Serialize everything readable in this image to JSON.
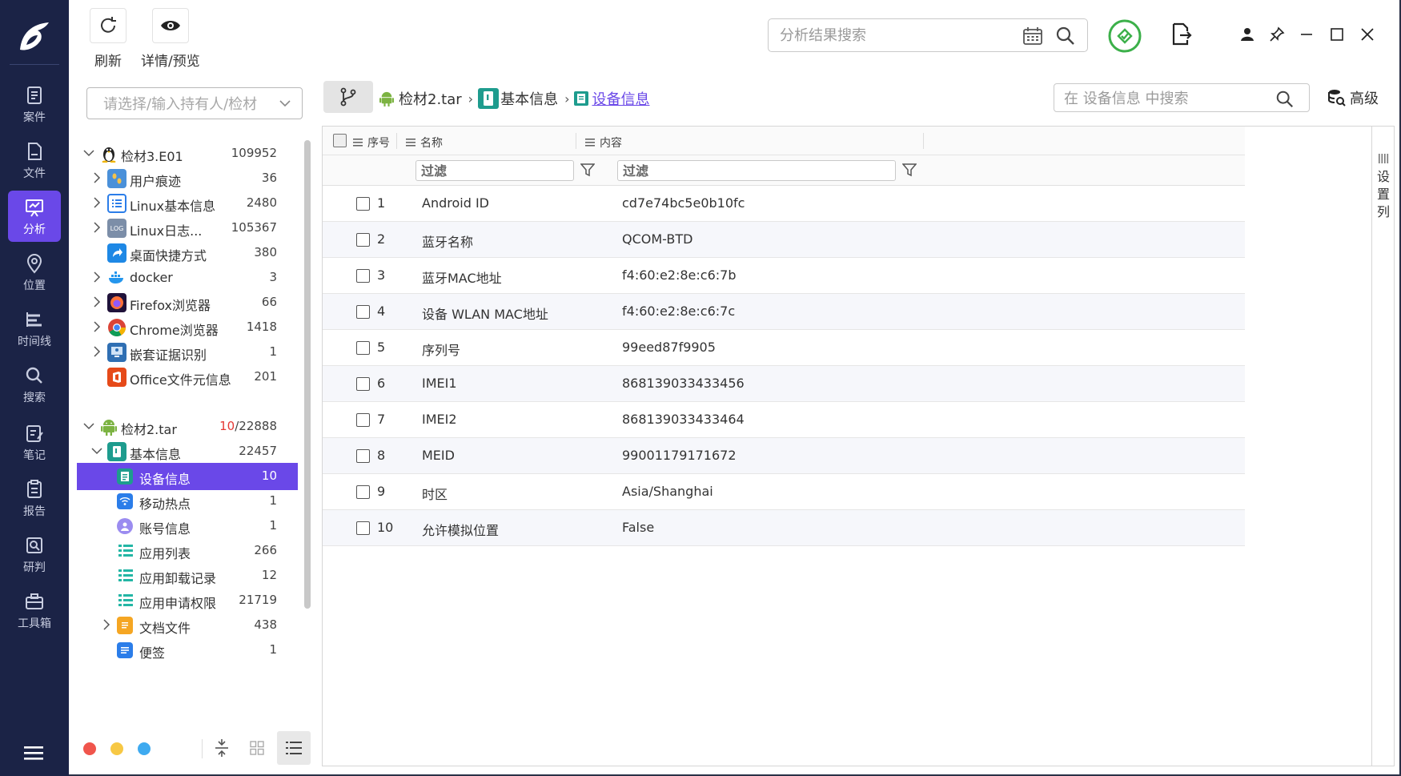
{
  "nav": {
    "items": [
      {
        "label": "案件",
        "icon": "case-icon"
      },
      {
        "label": "文件",
        "icon": "file-icon"
      },
      {
        "label": "分析",
        "icon": "analysis-icon",
        "active": true
      },
      {
        "label": "位置",
        "icon": "location-icon"
      },
      {
        "label": "时间线",
        "icon": "timeline-icon"
      },
      {
        "label": "搜索",
        "icon": "search-icon"
      },
      {
        "label": "笔记",
        "icon": "notes-icon"
      },
      {
        "label": "报告",
        "icon": "report-icon"
      },
      {
        "label": "研判",
        "icon": "judge-icon"
      },
      {
        "label": "工具箱",
        "icon": "toolbox-icon"
      }
    ]
  },
  "toolbar": {
    "refresh_label": "刷新",
    "detail_label": "详情/预览",
    "search_placeholder": "分析结果搜索"
  },
  "left": {
    "holder_placeholder": "请选择/输入持有人/检材",
    "tree": [
      {
        "name": "检材3.E01",
        "count": "109952"
      },
      {
        "name": "用户痕迹",
        "count": "36"
      },
      {
        "name": "Linux基本信息",
        "count": "2480"
      },
      {
        "name": "Linux日志...",
        "count": "105367"
      },
      {
        "name": "桌面快捷方式",
        "count": "380"
      },
      {
        "name": "docker",
        "count": "3"
      },
      {
        "name": "Firefox浏览器",
        "count": "66"
      },
      {
        "name": "Chrome浏览器",
        "count": "1418"
      },
      {
        "name": "嵌套证据识别",
        "count": "1"
      },
      {
        "name": "Office文件元信息",
        "count": "201"
      },
      {
        "name": "检材2.tar",
        "count_red": "10",
        "count": "/22888"
      },
      {
        "name": "基本信息",
        "count": "22457"
      },
      {
        "name": "设备信息",
        "count": "10"
      },
      {
        "name": "移动热点",
        "count": "1"
      },
      {
        "name": "账号信息",
        "count": "1"
      },
      {
        "name": "应用列表",
        "count": "266"
      },
      {
        "name": "应用卸载记录",
        "count": "12"
      },
      {
        "name": "应用申请权限",
        "count": "21719"
      },
      {
        "name": "文档文件",
        "count": "438"
      },
      {
        "name": "便签",
        "count": "1"
      }
    ]
  },
  "breadcrumb": {
    "items": [
      "检材2.tar",
      "基本信息",
      "设备信息"
    ],
    "search_placeholder": "在 设备信息 中搜索",
    "advanced_label": "高级"
  },
  "table": {
    "headers": {
      "index": "序号",
      "name": "名称",
      "content": "内容"
    },
    "filter_placeholder": "过滤",
    "rows": [
      {
        "no": "1",
        "name": "Android ID",
        "value": "cd7e74bc5e0b10fc"
      },
      {
        "no": "2",
        "name": "蓝牙名称",
        "value": "QCOM-BTD"
      },
      {
        "no": "3",
        "name": "蓝牙MAC地址",
        "value": "f4:60:e2:8e:c6:7b"
      },
      {
        "no": "4",
        "name": "设备 WLAN MAC地址",
        "value": "f4:60:e2:8e:c6:7c"
      },
      {
        "no": "5",
        "name": "序列号",
        "value": "99eed87f9905"
      },
      {
        "no": "6",
        "name": "IMEI1",
        "value": "868139033433456"
      },
      {
        "no": "7",
        "name": "IMEI2",
        "value": "868139033433464"
      },
      {
        "no": "8",
        "name": "MEID",
        "value": "99001179171672"
      },
      {
        "no": "9",
        "name": "时区",
        "value": "Asia/Shanghai"
      },
      {
        "no": "10",
        "name": "允许模拟位置",
        "value": "False"
      }
    ],
    "column_settings_label": "设置列"
  },
  "colors": {
    "accent": "#6a48e8",
    "nav_bg": "#1b2346",
    "count_red": "#e53935",
    "shield_green": "#3cb04a"
  }
}
